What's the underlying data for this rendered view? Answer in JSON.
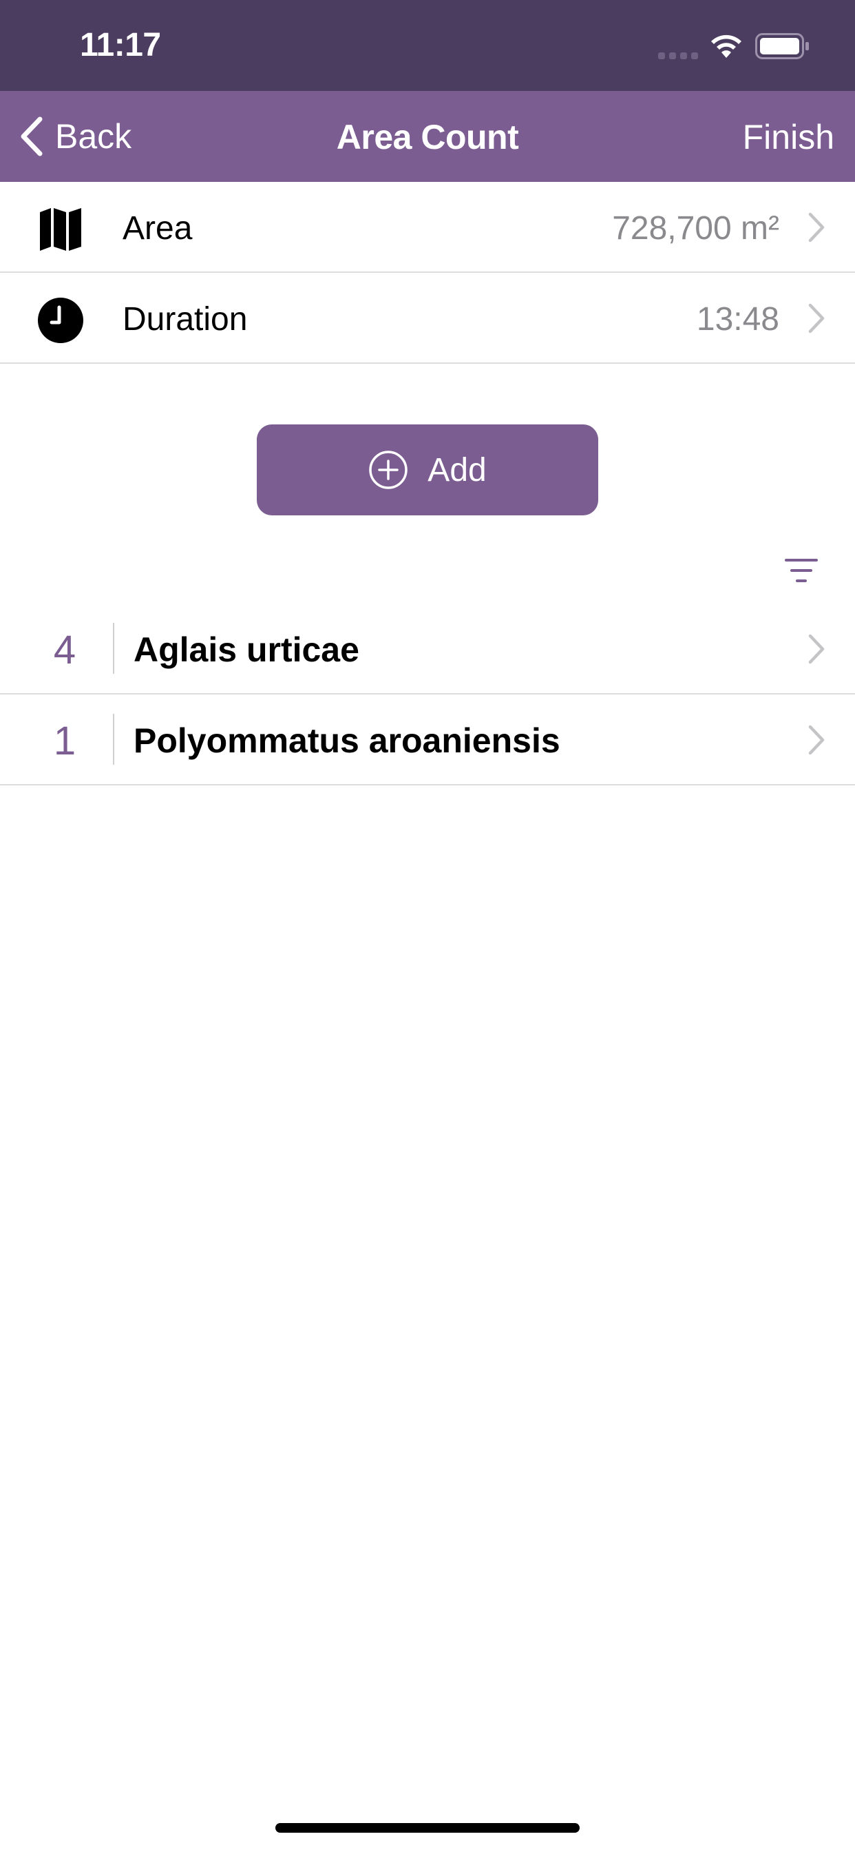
{
  "status_bar": {
    "time": "11:17"
  },
  "nav": {
    "back_label": "Back",
    "title": "Area Count",
    "finish_label": "Finish"
  },
  "info_rows": [
    {
      "label": "Area",
      "value": "728,700 m²",
      "icon": "map-icon"
    },
    {
      "label": "Duration",
      "value": "13:48",
      "icon": "clock-icon"
    }
  ],
  "add_button": {
    "label": "Add",
    "icon": "plus-circle-icon"
  },
  "filter": {
    "icon": "filter-icon"
  },
  "species": [
    {
      "count": "4",
      "name": "Aglais urticae"
    },
    {
      "count": "1",
      "name": "Polyommatus aroaniensis"
    }
  ],
  "colors": {
    "status_bar_bg": "#4b3d5f",
    "nav_bg": "#7b5d92",
    "accent": "#7b5d92",
    "secondary_text": "#8a8a8e",
    "separator": "#dcdcdc"
  }
}
